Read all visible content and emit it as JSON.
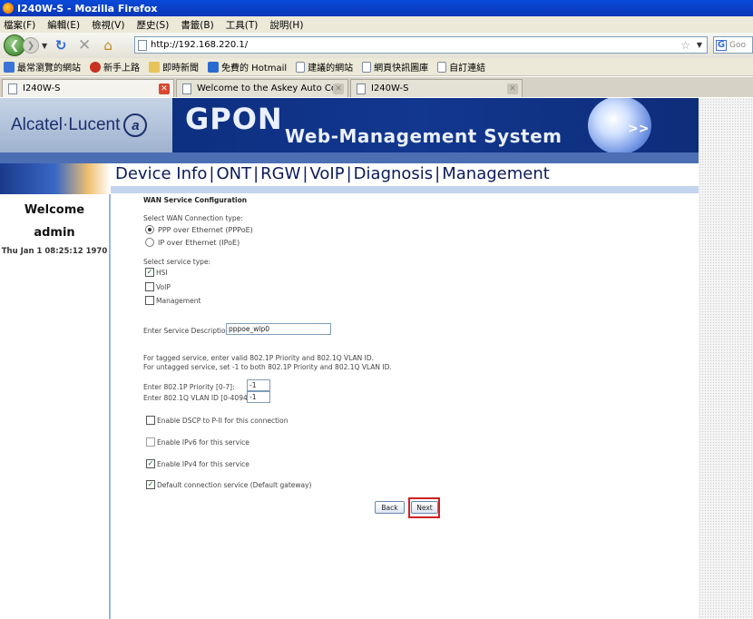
{
  "window": {
    "title": "I240W-S - Mozilla Firefox"
  },
  "menubar": [
    "檔案(F)",
    "編輯(E)",
    "檢視(V)",
    "歷史(S)",
    "書籤(B)",
    "工具(T)",
    "說明(H)"
  ],
  "toolbar": {
    "url": "http://192.168.220.1/",
    "search_placeholder": "Goo"
  },
  "bookmarks": [
    "最常瀏覽的網站",
    "新手上路",
    "即時新聞",
    "免費的 Hotmail",
    "建議的網站",
    "網頁快訊圖庫",
    "自訂連結"
  ],
  "tabs": [
    {
      "label": "I240W-S"
    },
    {
      "label": "Welcome to the Askey Auto Configurati..."
    },
    {
      "label": "I240W-S"
    }
  ],
  "banner": {
    "brand": "Alcatel·Lucent",
    "logo_mark": "a",
    "product": "GPON",
    "subtitle": "Web-Management System",
    "globe_arrows": ">>"
  },
  "nav": {
    "items": [
      "Device Info",
      "ONT",
      "RGW",
      "VoIP",
      "Diagnosis",
      "Management"
    ],
    "separator": "|"
  },
  "sidebar": {
    "welcome": "Welcome",
    "user": "admin",
    "clock": "Thu Jan 1 08:25:12 1970"
  },
  "form": {
    "heading": "WAN Service Configuration",
    "conn_type_label": "Select WAN Connection type:",
    "conn_options": [
      "PPP over Ethernet (PPPoE)",
      "IP over Ethernet (IPoE)"
    ],
    "conn_selected": 0,
    "service_type_label": "Select service type:",
    "service_types": [
      {
        "label": "HSI",
        "checked": true
      },
      {
        "label": "VoIP",
        "checked": false
      },
      {
        "label": "Management",
        "checked": false
      }
    ],
    "desc_label": "Enter Service Description:",
    "desc_value": "pppoe_wlp0",
    "tagged_note": "For tagged service, enter valid 802.1P Priority and 802.1Q VLAN ID.",
    "untagged_note": "For untagged service, set -1 to both 802.1P Priority and 802.1Q VLAN ID.",
    "priority_label": "Enter 802.1P Priority [0-7]:",
    "priority_value": "-1",
    "vlan_label": "Enter 802.1Q VLAN ID [0-4094]:",
    "vlan_value": "-1",
    "options": [
      {
        "label": "Enable DSCP to P-II for this connection",
        "checked": false
      },
      {
        "label": "Enable IPv6 for this service",
        "checked": false
      },
      {
        "label": "Enable IPv4 for this service",
        "checked": true
      },
      {
        "label": "Default connection service (Default gateway)",
        "checked": true
      }
    ],
    "back_label": "Back",
    "next_label": "Next"
  }
}
